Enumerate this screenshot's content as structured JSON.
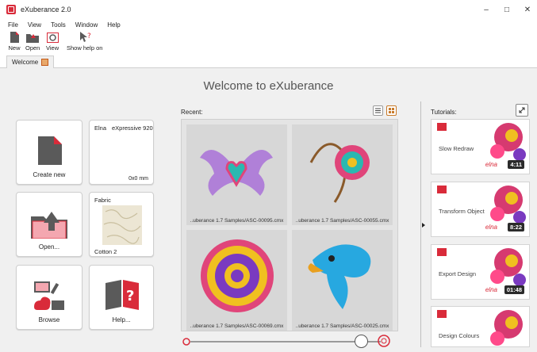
{
  "window": {
    "title": "eXuberance 2.0",
    "minimize": "–",
    "maximize": "□",
    "close": "✕"
  },
  "menu": [
    "File",
    "View",
    "Tools",
    "Window",
    "Help"
  ],
  "toolbar": {
    "new": "New",
    "open": "Open",
    "view": "View",
    "help": "Show help on"
  },
  "tab": {
    "label": "Welcome"
  },
  "welcome": {
    "title": "Welcome to eXuberance"
  },
  "tiles": {
    "create": "Create new",
    "machine_name": "Elna",
    "machine_model": "eXpressive 920",
    "hoop_size": "0x0 mm",
    "open": "Open...",
    "fabric_label": "Fabric",
    "fabric_name": "Cotton 2",
    "browse": "Browse",
    "help": "Help..."
  },
  "recent": {
    "label": "Recent:",
    "items": [
      "..uberance 1.7 Samples/ASC-00095.cmx",
      "..uberance 1.7 Samples/ASC-00055.cmx",
      "..uberance 1.7 Samples/ASC-00069.cmx",
      "..uberance 1.7 Samples/ASC-00025.cmx"
    ]
  },
  "tutorials": {
    "label": "Tutorials:",
    "brand": "elna",
    "items": [
      {
        "title": "Slow Redraw",
        "duration": "4:11"
      },
      {
        "title": "Transform Object",
        "duration": "8:22"
      },
      {
        "title": "Export Design",
        "duration": "01:48"
      },
      {
        "title": "Design Colours",
        "duration": ""
      }
    ]
  },
  "colors": {
    "accent": "#d92b3a",
    "panel": "#e4e4e4",
    "background": "#f0f0f0"
  }
}
